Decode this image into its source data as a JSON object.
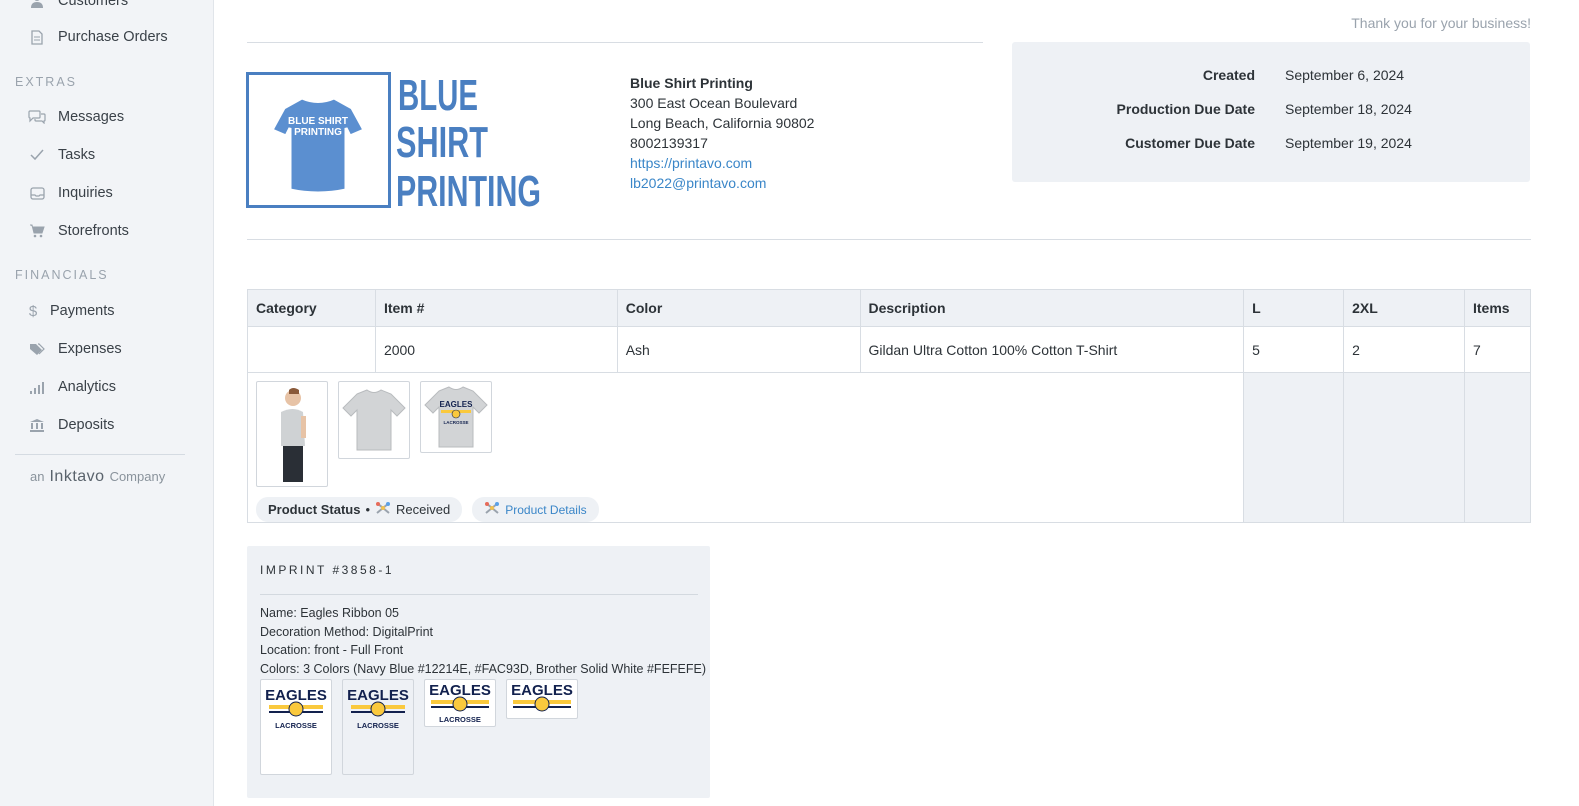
{
  "sidebar": {
    "items_top": [
      {
        "label": "Customers",
        "icon": "person-icon"
      },
      {
        "label": "Purchase Orders",
        "icon": "document-icon"
      }
    ],
    "extras_label": "EXTRAS",
    "extras": [
      {
        "label": "Messages",
        "icon": "chat-icon"
      },
      {
        "label": "Tasks",
        "icon": "check-icon"
      },
      {
        "label": "Inquiries",
        "icon": "inbox-icon"
      },
      {
        "label": "Storefronts",
        "icon": "cart-icon"
      }
    ],
    "financials_label": "FINANCIALS",
    "financials": [
      {
        "label": "Payments",
        "icon": "dollar-icon"
      },
      {
        "label": "Expenses",
        "icon": "tag-icon"
      },
      {
        "label": "Analytics",
        "icon": "bars-icon"
      },
      {
        "label": "Deposits",
        "icon": "bank-icon"
      }
    ],
    "brand_prefix": "an",
    "brand_name": "Inktavo",
    "brand_suffix": "Company"
  },
  "header": {
    "thank_you": "Thank you for your business!"
  },
  "logo": {
    "shirt_text_1": "BLUE SHIRT",
    "shirt_text_2": "PRINTING",
    "word_1": "BLUE",
    "word_2": "SHIRT",
    "word_3": "PRINTING",
    "accent_color": "#4a7fc1"
  },
  "company": {
    "name": "Blue Shirt Printing",
    "address_1": "300 East Ocean Boulevard",
    "address_2": "Long Beach, California 90802",
    "phone": "8002139317",
    "website": "https://printavo.com",
    "email": "lb2022@printavo.com"
  },
  "dates": {
    "created_label": "Created",
    "created_value": "September 6, 2024",
    "production_label": "Production Due Date",
    "production_value": "September 18, 2024",
    "customer_label": "Customer Due Date",
    "customer_value": "September 19, 2024"
  },
  "table": {
    "headers": {
      "category": "Category",
      "item": "Item #",
      "color": "Color",
      "description": "Description",
      "l": "L",
      "xxl": "2XL",
      "items": "Items"
    },
    "row": {
      "category": "",
      "item": "2000",
      "color": "Ash",
      "description": "Gildan Ultra Cotton 100% Cotton T-Shirt",
      "l": "5",
      "xxl": "2",
      "items": "7"
    },
    "product_status_label": "Product Status",
    "product_status_sep": "•",
    "product_status_value": "Received",
    "product_details_label": "Product Details"
  },
  "imprint": {
    "title": "IMPRINT #3858-1",
    "name": "Name: Eagles Ribbon 05",
    "method": "Decoration Method: DigitalPrint",
    "location": "Location: front - Full Front",
    "colors": "Colors: 3 Colors (Navy Blue #12214E, #FAC93D, Brother Solid White #FEFEFE)",
    "mock_text_1": "EAGLES",
    "mock_text_2": "LACROSSE",
    "navy": "#12214E",
    "gold": "#FAC93D"
  }
}
